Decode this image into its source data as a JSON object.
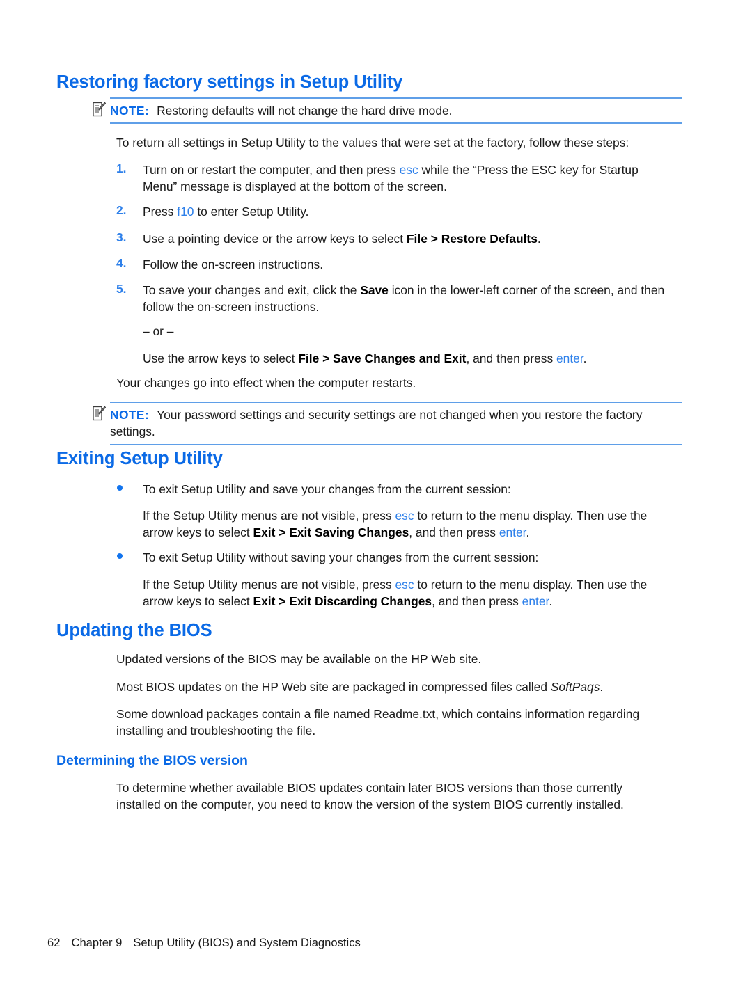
{
  "page": {
    "number": "62",
    "footer_chapter": "Chapter 9",
    "footer_title": "Setup Utility (BIOS) and System Diagnostics"
  },
  "colors": {
    "heading_blue": "#0b6ae6",
    "keyword_blue": "#2e80ea",
    "note_rule_blue": "#5f9fe8",
    "bullet_blue": "#1274ee",
    "body_black": "#1a1a1a"
  },
  "icons": {
    "note": "note-pencil-icon"
  },
  "sections": {
    "restoring": {
      "heading": "Restoring factory settings in Setup Utility",
      "note1": {
        "label": "NOTE:",
        "text": "Restoring defaults will not change the hard drive mode."
      },
      "intro": "To return all settings in Setup Utility to the values that were set at the factory, follow these steps:",
      "steps": [
        {
          "marker": "1.",
          "parts": [
            {
              "t": "Turn on or restart the computer, and then press ",
              "s": "plain"
            },
            {
              "t": "esc",
              "s": "kw"
            },
            {
              "t": " while the “Press the ESC key for Startup Menu” message is displayed at the bottom of the screen.",
              "s": "plain"
            }
          ]
        },
        {
          "marker": "2.",
          "parts": [
            {
              "t": "Press ",
              "s": "plain"
            },
            {
              "t": "f10",
              "s": "kw"
            },
            {
              "t": " to enter Setup Utility.",
              "s": "plain"
            }
          ]
        },
        {
          "marker": "3.",
          "parts": [
            {
              "t": "Use a pointing device or the arrow keys to select ",
              "s": "plain"
            },
            {
              "t": "File > Restore Defaults",
              "s": "b"
            },
            {
              "t": ".",
              "s": "plain"
            }
          ]
        },
        {
          "marker": "4.",
          "parts": [
            {
              "t": "Follow the on-screen instructions.",
              "s": "plain"
            }
          ]
        },
        {
          "marker": "5.",
          "parts": [
            {
              "t": "To save your changes and exit, click the ",
              "s": "plain"
            },
            {
              "t": "Save",
              "s": "b"
            },
            {
              "t": " icon in the lower-left corner of the screen, and then follow the on-screen instructions.",
              "s": "plain"
            }
          ]
        }
      ],
      "or_divider": "– or –",
      "alt_step": [
        {
          "t": "Use the arrow keys to select ",
          "s": "plain"
        },
        {
          "t": "File > Save Changes and Exit",
          "s": "b"
        },
        {
          "t": ", and then press ",
          "s": "plain"
        },
        {
          "t": "enter",
          "s": "kw"
        },
        {
          "t": ".",
          "s": "plain"
        }
      ],
      "closing": "Your changes go into effect when the computer restarts.",
      "note2": {
        "label": "NOTE:",
        "text": "Your password settings and security settings are not changed when you restore the factory settings."
      }
    },
    "exiting": {
      "heading": "Exiting Setup Utility",
      "bullets": [
        {
          "lead": "To exit Setup Utility and save your changes from the current session:",
          "detail": [
            {
              "t": "If the Setup Utility menus are not visible, press ",
              "s": "plain"
            },
            {
              "t": "esc",
              "s": "kw"
            },
            {
              "t": " to return to the menu display. Then use the arrow keys to select ",
              "s": "plain"
            },
            {
              "t": "Exit > Exit Saving Changes",
              "s": "b"
            },
            {
              "t": ", and then press ",
              "s": "plain"
            },
            {
              "t": "enter",
              "s": "kw"
            },
            {
              "t": ".",
              "s": "plain"
            }
          ]
        },
        {
          "lead": "To exit Setup Utility without saving your changes from the current session:",
          "detail": [
            {
              "t": "If the Setup Utility menus are not visible, press ",
              "s": "plain"
            },
            {
              "t": "esc",
              "s": "kw"
            },
            {
              "t": " to return to the menu display. Then use the arrow keys to select ",
              "s": "plain"
            },
            {
              "t": "Exit > Exit Discarding Changes",
              "s": "b"
            },
            {
              "t": ", and then press ",
              "s": "plain"
            },
            {
              "t": "enter",
              "s": "kw"
            },
            {
              "t": ".",
              "s": "plain"
            }
          ]
        }
      ]
    },
    "updating": {
      "heading": "Updating the BIOS",
      "paragraphs": [
        [
          {
            "t": "Updated versions of the BIOS may be available on the HP Web site.",
            "s": "plain"
          }
        ],
        [
          {
            "t": "Most BIOS updates on the HP Web site are packaged in compressed files called ",
            "s": "plain"
          },
          {
            "t": "SoftPaqs",
            "s": "i"
          },
          {
            "t": ".",
            "s": "plain"
          }
        ],
        [
          {
            "t": "Some download packages contain a file named Readme.txt, which contains information regarding installing and troubleshooting the file.",
            "s": "plain"
          }
        ]
      ],
      "subsection": {
        "heading": "Determining the BIOS version",
        "paragraph": "To determine whether available BIOS updates contain later BIOS versions than those currently installed on the computer, you need to know the version of the system BIOS currently installed."
      }
    }
  }
}
